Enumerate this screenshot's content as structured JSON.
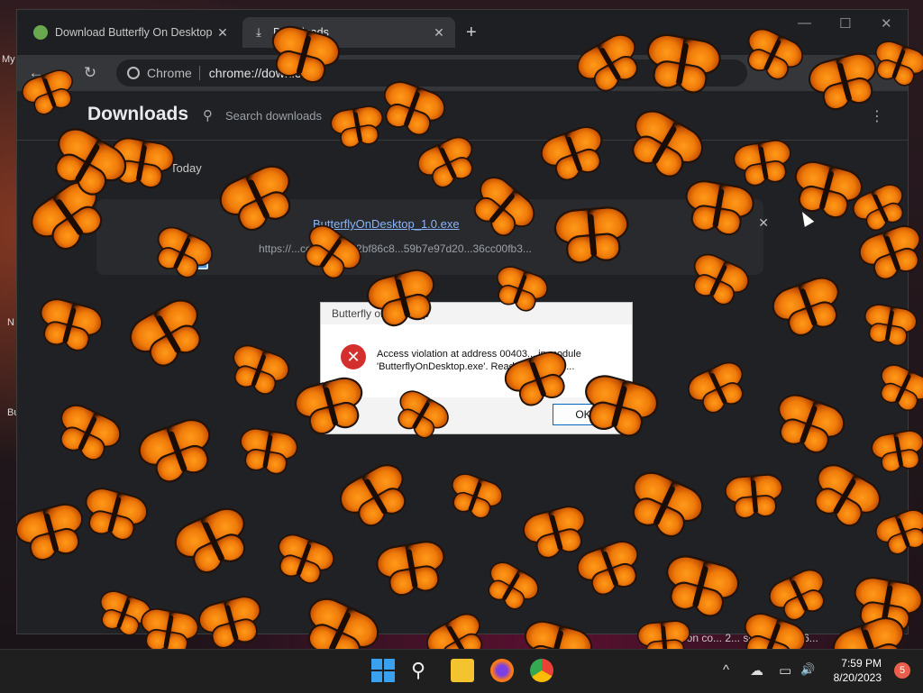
{
  "desktop": {
    "icon_labels": [
      "My",
      "N",
      "Bu"
    ]
  },
  "chrome": {
    "tabs": [
      {
        "title": "Download Butterfly On Desktop",
        "active": false,
        "favicon": "butterfly-site-favicon"
      },
      {
        "title": "Downloads",
        "active": true,
        "favicon": "download-icon"
      }
    ],
    "new_tab_symbol": "+",
    "window_controls": {
      "minimize": "—",
      "maximize": "☐",
      "close": "✕"
    },
    "toolbar": {
      "back": "←",
      "forward": "→",
      "reload": "↻"
    },
    "omnibox": {
      "chip": "Chrome",
      "url": "chrome://downloads"
    }
  },
  "downloads": {
    "title": "Downloads",
    "search_placeholder": "Search downloads",
    "date_heading": "Today",
    "item": {
      "filename": "ButterflyOnDesktop_1.0.exe",
      "url": "https://...com/soft32/2bf86c8...59b7e97d20...36cc00fb3...",
      "close_symbol": "✕"
    },
    "status_url": "...ation co... 2... se.230520-16..."
  },
  "dialog": {
    "title": "Butterfly on Desktop",
    "message": "Access violation at address 00403... in module 'ButterflyOnDesktop.exe'. Read of address ...",
    "ok_label": "OK"
  },
  "taskbar": {
    "icons": [
      "start-icon",
      "search-icon",
      "file-explorer-icon",
      "firefox-icon",
      "chrome-icon"
    ],
    "tray": {
      "chevron": "^",
      "onedrive": "☁",
      "network": "▭",
      "volume": "🔊"
    },
    "time": "7:59 PM",
    "date": "8/20/2023",
    "notification_count": "5"
  },
  "colors": {
    "butterfly_orange": "#f07c0a",
    "butterfly_black": "#231208",
    "chrome_dark": "#202124",
    "link_blue": "#8ab4f8",
    "error_red": "#d32f2f"
  }
}
